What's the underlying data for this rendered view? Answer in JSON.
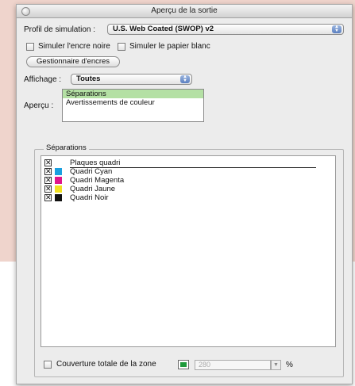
{
  "window": {
    "title": "Aperçu de la sortie"
  },
  "profile": {
    "label": "Profil de simulation :",
    "value": "U.S. Web Coated (SWOP) v2"
  },
  "options": {
    "simulate_black_ink": "Simuler l'encre noire",
    "simulate_paper_white": "Simuler le papier blanc"
  },
  "ink_manager_button": "Gestionnaire d'encres",
  "display": {
    "label": "Affichage :",
    "value": "Toutes"
  },
  "preview": {
    "label": "Aperçu :",
    "items": [
      {
        "label": "Séparations",
        "selected": true
      },
      {
        "label": "Avertissements de couleur",
        "selected": false
      }
    ]
  },
  "separations": {
    "title": "Séparations",
    "rows": [
      {
        "label": "Plaques quadri",
        "checked": true,
        "color": ""
      },
      {
        "label": "Quadri Cyan",
        "checked": true,
        "color": "#1aa0e0"
      },
      {
        "label": "Quadri Magenta",
        "checked": true,
        "color": "#e0168a"
      },
      {
        "label": "Quadri Jaune",
        "checked": true,
        "color": "#f0e020"
      },
      {
        "label": "Quadri Noir",
        "checked": true,
        "color": "#111111"
      }
    ]
  },
  "coverage": {
    "label": "Couverture totale de la zone",
    "value": "280",
    "unit": "%",
    "swatch_color": "#1f9a3b"
  }
}
